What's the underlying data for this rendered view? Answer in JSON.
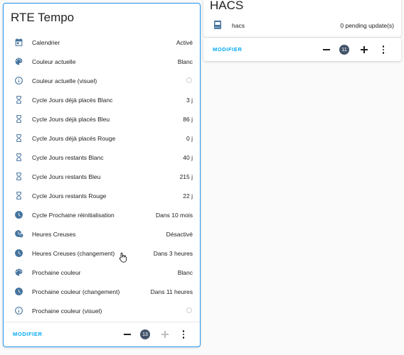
{
  "rte_card": {
    "title": "RTE Tempo",
    "rows": [
      {
        "icon": "calendar-icon",
        "label": "Calendrier",
        "value": "Activé"
      },
      {
        "icon": "palette-icon",
        "label": "Couleur actuelle",
        "value": "Blanc"
      },
      {
        "icon": "info-icon",
        "label": "Couleur actuelle (visuel)",
        "value": ""
      },
      {
        "icon": "hourglass-icon",
        "label": "Cycle Jours déjà placés Blanc",
        "value": "3 j"
      },
      {
        "icon": "hourglass-icon",
        "label": "Cycle Jours déjà placés Bleu",
        "value": "86 j"
      },
      {
        "icon": "hourglass-icon",
        "label": "Cycle Jours déjà placés Rouge",
        "value": "0 j"
      },
      {
        "icon": "hourglass-icon",
        "label": "Cycle Jours restants Blanc",
        "value": "40 j"
      },
      {
        "icon": "hourglass-icon",
        "label": "Cycle Jours restants Bleu",
        "value": "215 j"
      },
      {
        "icon": "hourglass-icon",
        "label": "Cycle Jours restants Rouge",
        "value": "22 j"
      },
      {
        "icon": "clock-icon",
        "label": "Cycle Prochaine réinitialisation",
        "value": "Dans 10 mois"
      },
      {
        "icon": "clock-alert-icon",
        "label": "Heures Creuses",
        "value": "Désactivé"
      },
      {
        "icon": "clock-icon",
        "label": "Heures Creuses (changement)",
        "value": "Dans 3 heures"
      },
      {
        "icon": "palette-icon",
        "label": "Prochaine couleur",
        "value": "Blanc"
      },
      {
        "icon": "clock-icon",
        "label": "Prochaine couleur (changement)",
        "value": "Dans 11 heures"
      },
      {
        "icon": "info-icon",
        "label": "Prochaine couleur (visuel)",
        "value": ""
      }
    ],
    "footer": {
      "modifier": "MODIFIER",
      "count": "13"
    }
  },
  "hacs_card": {
    "title": "HACS",
    "row": {
      "icon": "hacs-icon",
      "label": "hacs",
      "value": "0 pending update(s)"
    },
    "footer": {
      "modifier": "MODIFIER",
      "count": "11"
    }
  },
  "colors": {
    "accent": "#03a9f4",
    "icon": "#44739e",
    "badge": "#44546a",
    "selected_border": "#2196f3"
  }
}
